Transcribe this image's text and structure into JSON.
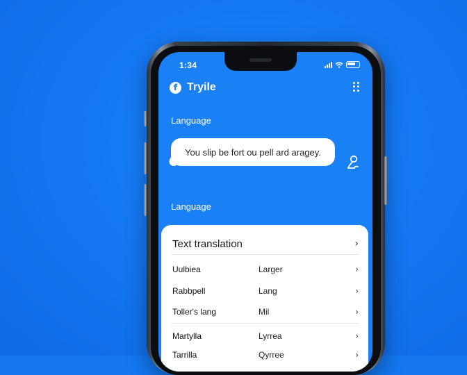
{
  "status_bar": {
    "time": "1:34"
  },
  "app": {
    "logo_glyph": "f",
    "title": "Tryile"
  },
  "sections": {
    "language_label_1": "Language",
    "language_label_2": "Language"
  },
  "bubble": {
    "text": "You slip be fort ou pell ard aragey."
  },
  "card": {
    "title": "Text translation",
    "chevron": "›",
    "rows": [
      {
        "left": "Uulbiea",
        "right": "Larger",
        "chevron": "›"
      },
      {
        "left": "Rabbpell",
        "right": "Lang",
        "chevron": "›"
      },
      {
        "left": "Toller's lang",
        "right": "Mil",
        "chevron": "›"
      },
      {
        "left": "Martylla",
        "right": "Lyrrea",
        "chevron": "›"
      },
      {
        "left": "Tarrilla",
        "right": "Qyrree",
        "chevron": "›"
      }
    ]
  },
  "colors": {
    "background": "#1477f0",
    "screen": "#1a80f6",
    "card": "#ffffff"
  }
}
